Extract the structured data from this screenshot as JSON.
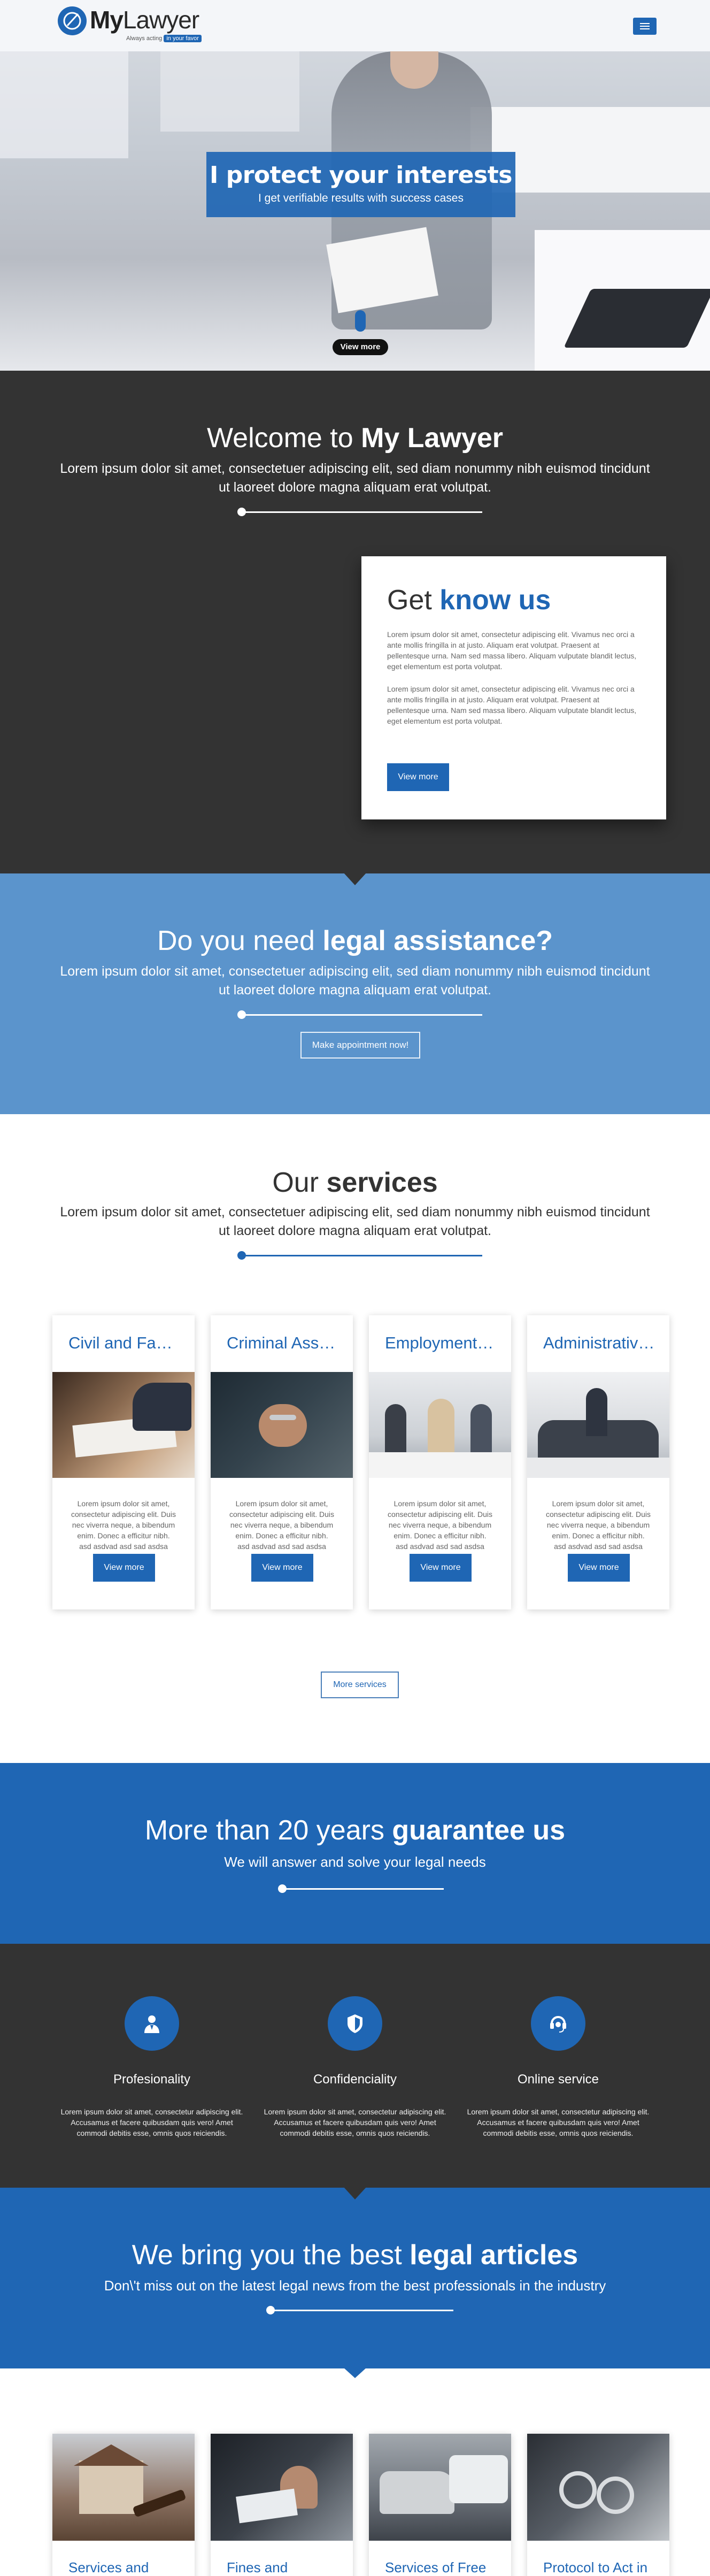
{
  "header": {
    "logo_text_my": "My",
    "logo_text_lawyer": "Lawyer",
    "logo_tagline": "Always acting",
    "logo_tagline_highlight": "in your favor",
    "menu_icon": "hamburger-menu-icon"
  },
  "hero": {
    "title": "I protect your interests",
    "subtitle": "I get verifiable results with success cases",
    "view_more": "View more"
  },
  "welcome": {
    "title_plain": "Welcome to",
    "title_bold": "My Lawyer",
    "text": "Lorem ipsum dolor sit amet, consectetuer adipiscing elit, sed diam nonummy nibh euismod tincidunt ut laoreet dolore magna aliquam erat volutpat.",
    "know_title_plain": "Get",
    "know_title_bold": "know us",
    "know_p1": "Lorem ipsum dolor sit amet, consectetur adipiscing elit. Vivamus nec orci a ante mollis fringilla in at justo. Aliquam erat volutpat. Praesent at pellentesque urna. Nam sed massa libero. Aliquam vulputate blandit lectus, eget elementum est porta volutpat.",
    "know_p2": "Lorem ipsum dolor sit amet, consectetur adipiscing elit. Vivamus nec orci a ante mollis fringilla in at justo. Aliquam erat volutpat. Praesent at pellentesque urna. Nam sed massa libero. Aliquam vulputate blandit lectus, eget elementum est porta volutpat.",
    "know_button": "View more"
  },
  "assist": {
    "title_plain": "Do you need",
    "title_bold": "legal assistance?",
    "text": "Lorem ipsum dolor sit amet, consectetuer adipiscing elit, sed diam nonummy nibh euismod tincidunt ut laoreet dolore magna aliquam erat volutpat.",
    "button": "Make appointment now!"
  },
  "services": {
    "title_plain": "Our",
    "title_bold": "services",
    "text": "Lorem ipsum dolor sit amet, consectetuer adipiscing elit, sed diam nonummy nibh euismod tincidunt ut laoreet dolore magna aliquam erat volutpat.",
    "items": [
      {
        "title": "Civil and Fa…",
        "desc": "Lorem ipsum dolor sit amet, consectetur adipiscing elit. Duis nec viverra neque, a bibendum enim. Donec a efficitur nibh. asd asdvad asd sad asdsa",
        "button": "View more"
      },
      {
        "title": "Criminal Ass…",
        "desc": "Lorem ipsum dolor sit amet, consectetur adipiscing elit. Duis nec viverra neque, a bibendum enim. Donec a efficitur nibh. asd asdvad asd sad asdsa",
        "button": "View more"
      },
      {
        "title": "Employment…",
        "desc": "Lorem ipsum dolor sit amet, consectetur adipiscing elit. Duis nec viverra neque, a bibendum enim. Donec a efficitur nibh. asd asdvad asd sad asdsa",
        "button": "View more"
      },
      {
        "title": "Administrativ…",
        "desc": "Lorem ipsum dolor sit amet, consectetur adipiscing elit. Duis nec viverra neque, a bibendum enim. Donec a efficitur nibh. asd asdvad asd sad asdsa",
        "button": "View more"
      }
    ],
    "more_button": "More services"
  },
  "guarantee": {
    "title_plain": "More than 20 years",
    "title_bold": "guarantee us",
    "subtitle": "We will answer and solve your legal needs"
  },
  "features": [
    {
      "name": "Profesionality",
      "icon": "lawyer-icon",
      "desc": "Lorem ipsum dolor sit amet, consectetur adipiscing elit. Accusamus et facere quibusdam quis vero! Amet commodi debitis esse, omnis quos reiciendis."
    },
    {
      "name": "Confidenciality",
      "icon": "shield-icon",
      "desc": "Lorem ipsum dolor sit amet, consectetur adipiscing elit. Accusamus et facere quibusdam quis vero! Amet commodi debitis esse, omnis quos reiciendis."
    },
    {
      "name": "Online service",
      "icon": "support-icon",
      "desc": "Lorem ipsum dolor sit amet, consectetur adipiscing elit. Accusamus et facere quibusdam quis vero! Amet commodi debitis esse, omnis quos reiciendis."
    }
  ],
  "articles": {
    "title_plain": "We bring you the best",
    "title_bold": "legal articles",
    "subtitle": "Don\\'t miss out on the latest legal news from the best professionals in the industry",
    "items": [
      {
        "title": "Services and Legal"
      },
      {
        "title": "Fines and"
      },
      {
        "title": "Services of Free"
      },
      {
        "title": "Protocol to Act in"
      }
    ]
  },
  "colors": {
    "primary": "#1f66b4",
    "dark": "#333333",
    "light_blue": "#5b94cc"
  }
}
